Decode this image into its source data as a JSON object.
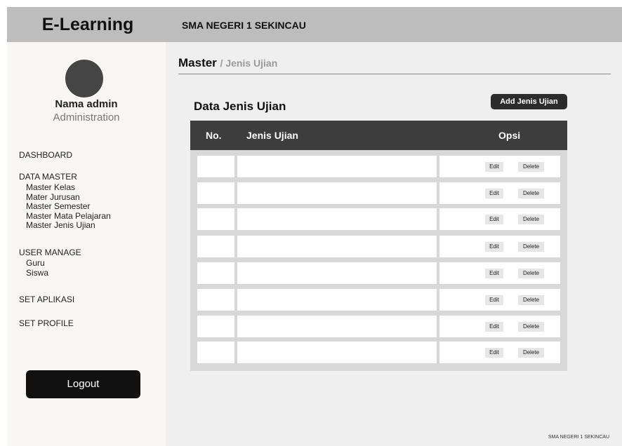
{
  "header": {
    "brand": "E-Learning",
    "school_name": "SMA NEGERI 1 SEKINCAU"
  },
  "sidebar": {
    "admin_name": "Nama admin",
    "admin_role": "Administration",
    "menu": [
      {
        "label": "DASHBOARD",
        "items": []
      },
      {
        "label": "DATA MASTER",
        "items": [
          "Master Kelas",
          "Mater Jurusan",
          "Master Semester",
          "Master Mata Pelajaran",
          "Master Jenis Ujian"
        ]
      },
      {
        "label": "USER MANAGE",
        "items": [
          "Guru",
          "Siswa"
        ]
      },
      {
        "label": "SET APLIKASI",
        "items": []
      },
      {
        "label": "SET PROFILE",
        "items": []
      }
    ],
    "logout_label": "Logout"
  },
  "breadcrumb": {
    "main": "Master",
    "sub": "/ Jenis Ujian"
  },
  "page": {
    "title": "Data Jenis Ujian",
    "add_button": "Add Jenis Ujian"
  },
  "table": {
    "columns": [
      "No.",
      "Jenis Ujian",
      "Opsi"
    ],
    "rows": [
      {
        "no": "",
        "jenis": "",
        "edit": "Edit",
        "delete": "Delete"
      },
      {
        "no": "",
        "jenis": "",
        "edit": "Edit",
        "delete": "Delete"
      },
      {
        "no": "",
        "jenis": "",
        "edit": "Edit",
        "delete": "Delete"
      },
      {
        "no": "",
        "jenis": "",
        "edit": "Edit",
        "delete": "Delete"
      },
      {
        "no": "",
        "jenis": "",
        "edit": "Edit",
        "delete": "Delete"
      },
      {
        "no": "",
        "jenis": "",
        "edit": "Edit",
        "delete": "Delete"
      },
      {
        "no": "",
        "jenis": "",
        "edit": "Edit",
        "delete": "Delete"
      },
      {
        "no": "",
        "jenis": "",
        "edit": "Edit",
        "delete": "Delete"
      }
    ]
  },
  "footer": {
    "text": "SMA NEGERI 1 SEKINCAU"
  }
}
